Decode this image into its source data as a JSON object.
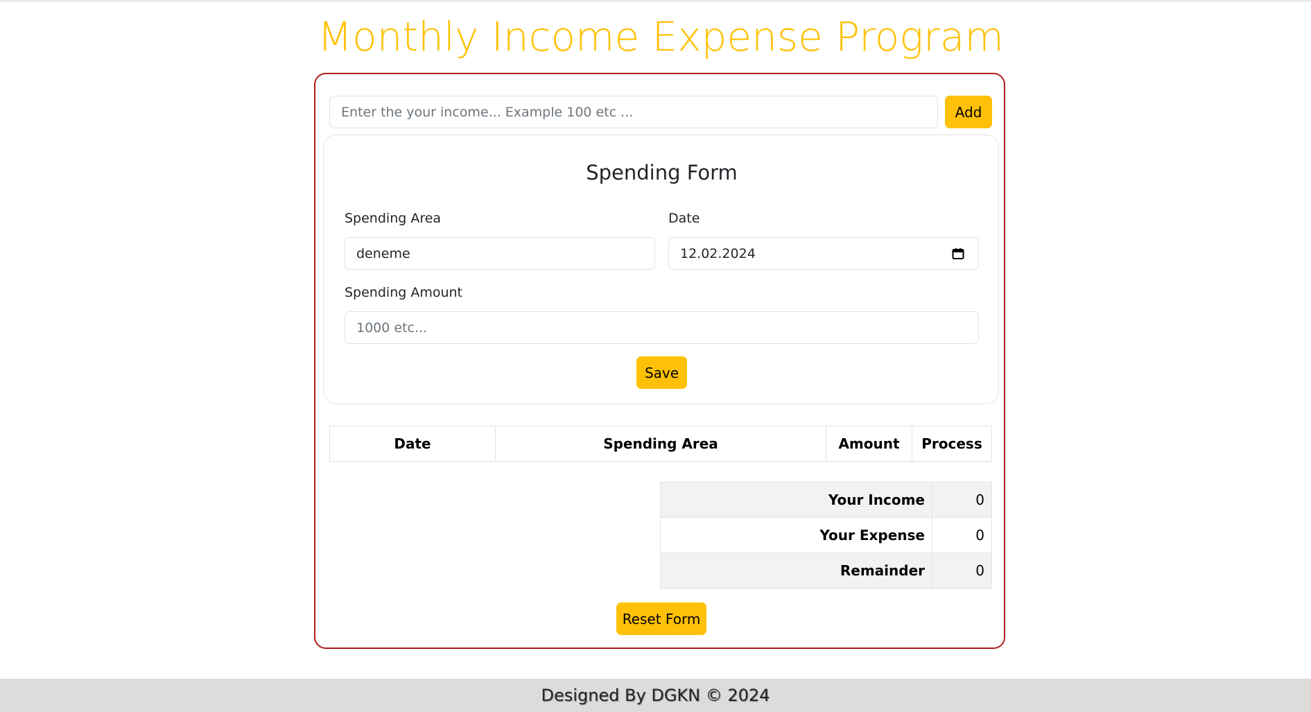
{
  "app": {
    "title": "Monthly Income Expense Program"
  },
  "income": {
    "placeholder": "Enter the your income... Example 100 etc ...",
    "value": "",
    "add_label": "Add"
  },
  "spending_form": {
    "title": "Spending Form",
    "area_label": "Spending Area",
    "area_value": "deneme",
    "date_label": "Date",
    "date_value": "12.02.2024",
    "amount_label": "Spending Amount",
    "amount_placeholder": "1000 etc...",
    "save_label": "Save"
  },
  "table": {
    "columns": [
      "Date",
      "Spending Area",
      "Amount",
      "Process"
    ],
    "rows": []
  },
  "summary": [
    {
      "label": "Your Income",
      "value": "0"
    },
    {
      "label": "Your Expense",
      "value": "0"
    },
    {
      "label": "Remainder",
      "value": "0"
    }
  ],
  "reset_label": "Reset Form",
  "footer": {
    "text": "Designed By DGKN © 2024"
  },
  "colors": {
    "accent": "#ffc107",
    "card_border": "#b01a1a",
    "footer_bg": "#dedbdb"
  },
  "icons": {
    "date_picker": "calendar-icon"
  }
}
